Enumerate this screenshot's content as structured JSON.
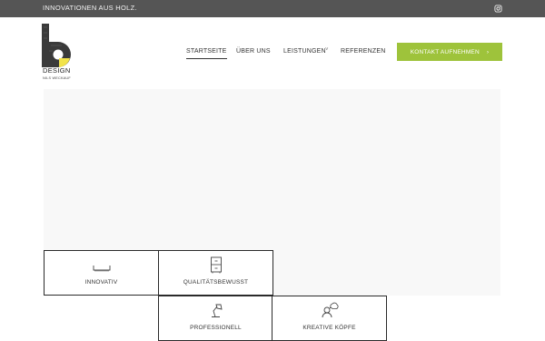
{
  "topbar": {
    "tagline": "INNOVATIONEN AUS HOLZ.",
    "instagram_icon": "instagram-icon"
  },
  "logo": {
    "title": "DESIGN",
    "subtitle": "NILS WECKAUF",
    "accent_color": "#f2e34a"
  },
  "nav": {
    "items": [
      "STARTSEITE",
      "ÜBER UNS",
      "LEISTUNGEN",
      "REFERENZEN"
    ],
    "active": "STARTSEITE",
    "dropdown_icon": "chevron-down-icon"
  },
  "cta": {
    "label": "KONTAKT AUFNEHMEN",
    "arrow": "›",
    "color": "#9ec33b"
  },
  "features": [
    {
      "label": "INNOVATIV",
      "icon": "saw-blade-icon"
    },
    {
      "label": "QUALITÄTSBEWUSST",
      "icon": "cabinet-icon"
    },
    {
      "label": "PROFESSIONELL",
      "icon": "desk-lamp-icon"
    },
    {
      "label": "KREATIVE KÖPFE",
      "icon": "brainstorm-icon"
    }
  ]
}
